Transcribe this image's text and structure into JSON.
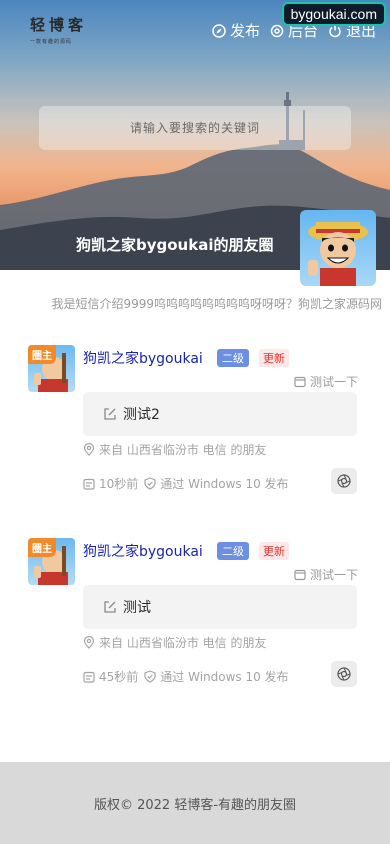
{
  "header": {
    "logo_title": "轻博客",
    "logo_subtitle": "一款有趣的源码",
    "nav": [
      {
        "label": "发布",
        "icon": "compass-icon"
      },
      {
        "label": "后台",
        "icon": "gear-icon"
      },
      {
        "label": "退出",
        "icon": "power-icon"
      }
    ],
    "watermark": "bygoukai.com"
  },
  "search": {
    "placeholder": "请输入要搜索的关键词"
  },
  "hero": {
    "title": "狗凯之家bygoukai的朋友圈"
  },
  "bio": "我是短信介绍9999呜呜呜呜呜呜呜呜呀呀呀？狗凯之家源码网",
  "posts": [
    {
      "avatar_tag": "圈主",
      "author": "狗凯之家bygoukai",
      "level": "二级",
      "new_badge": "更新",
      "extra": "测试一下",
      "content": "测试2",
      "location": "来自 山西省临汾市 电信 的朋友",
      "time": "10秒前",
      "via": "通过 Windows 10 发布"
    },
    {
      "avatar_tag": "圈主",
      "author": "狗凯之家bygoukai",
      "level": "二级",
      "new_badge": "更新",
      "extra": "测试一下",
      "content": "测试",
      "location": "来自 山西省临汾市 电信 的朋友",
      "time": "45秒前",
      "via": "通过 Windows 10 发布"
    }
  ],
  "footer": "版权© 2022 轻博客-有趣的朋友圈",
  "colors": {
    "author": "#1a23b0",
    "level_badge": "#6c8fe4",
    "new_badge_text": "#e0342f",
    "avatar_tag": "#f08a2a"
  }
}
